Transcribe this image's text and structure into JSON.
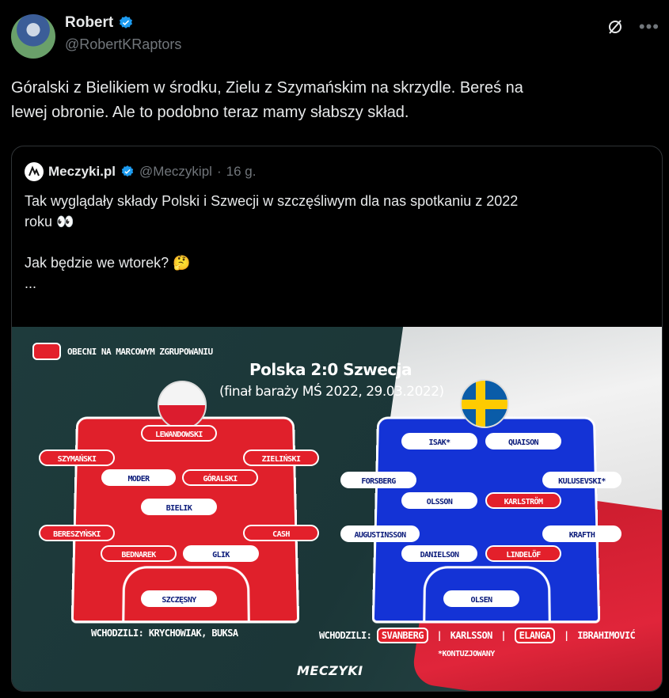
{
  "author": {
    "name": "Robert",
    "handle": "@RobertKRaptors",
    "verified_color": "#1d9bf0"
  },
  "icons": {
    "grok": "grok-icon",
    "more": "more-icon"
  },
  "tweet": {
    "lines": [
      "Góralski z Bielikiem w środku, Zielu z Szymańskim na skrzydle. Bereś na",
      "lewej obronie. Ale to podobno teraz mamy słabszy skład."
    ]
  },
  "quote": {
    "name": "Meczyki.pl",
    "handle": "@Meczykipl",
    "dot": "·",
    "time": "16 g.",
    "text": [
      "Tak wyglądały składy Polski i Szwecji w szczęśliwym dla nas spotkaniu z 2022",
      "roku 👀",
      "",
      "Jak będzie we wtorek? 🤔",
      "..."
    ]
  },
  "graphic": {
    "legend": "OBECNI NA MARCOWYM ZGRUPOWANIU",
    "title": "Polska 2:0 Szwecja",
    "subtitle": "(finał baraży MŚ 2022, 29.03.2022)",
    "poland": [
      "LEWANDOWSKI",
      "SZYMAŃSKI",
      "ZIELIŃSKI",
      "MODER",
      "GÓRALSKI",
      "BIELIK",
      "BERESZYŃSKI",
      "CASH",
      "BEDNAREK",
      "GLIK",
      "SZCZĘSNY"
    ],
    "sweden": [
      "ISAK*",
      "QUAISON",
      "FORSBERG",
      "KULUSEVSKI*",
      "OLSSON",
      "KARLSTRÖM",
      "AUGUSTINSSON",
      "KRAFTH",
      "DANIELSON",
      "LINDELÖF",
      "OLSEN"
    ],
    "subs_pl": "WCHODZILI: KRYCHOWIAK, BUKSA",
    "subs_se": {
      "prefix": "WCHODZILI:",
      "p1": "SVANBERG",
      "p2": "KARLSSON",
      "p3": "ELANGA",
      "p4": "IBRAHIMOVIĆ",
      "sep": "|"
    },
    "injury_note": "*KONTUZJOWANY",
    "brand": "MECZYKI",
    "colors": {
      "poland_red": "#e3202b",
      "sweden_blue": "#1433d6"
    }
  }
}
